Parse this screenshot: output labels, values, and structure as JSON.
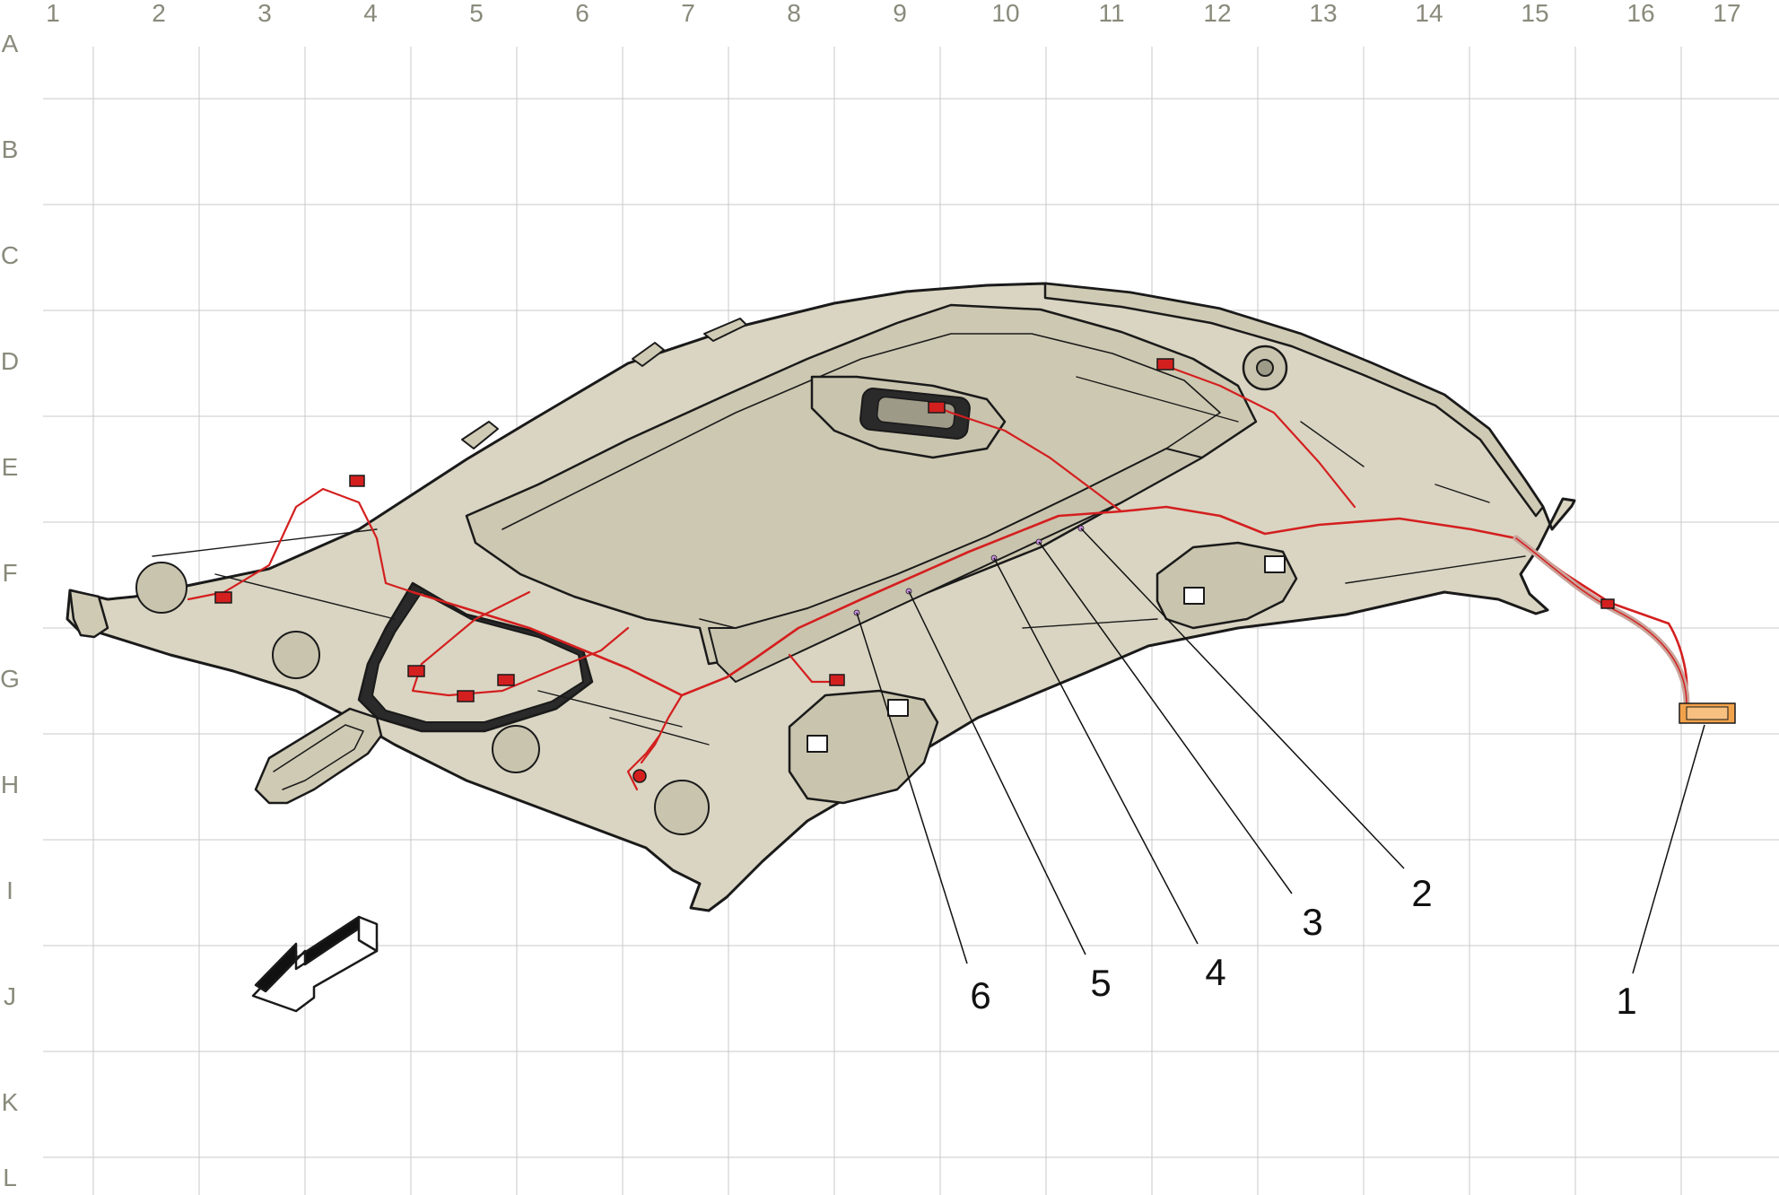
{
  "grid": {
    "columns": [
      "1",
      "2",
      "3",
      "4",
      "5",
      "6",
      "7",
      "8",
      "9",
      "10",
      "11",
      "12",
      "13",
      "14",
      "15",
      "16",
      "17"
    ],
    "rows": [
      "A",
      "B",
      "C",
      "D",
      "E",
      "F",
      "G",
      "H",
      "I",
      "J",
      "K",
      "L"
    ]
  },
  "callouts": [
    {
      "number": "1"
    },
    {
      "number": "2"
    },
    {
      "number": "3"
    },
    {
      "number": "4"
    },
    {
      "number": "5"
    },
    {
      "number": "6"
    }
  ],
  "colors": {
    "grid_line": "#c8c8c8",
    "label_gray": "#8a8a7c",
    "headliner_fill": "#d9d5c2",
    "headliner_shade": "#c9c4ae",
    "outline": "#1a1a1a",
    "harness_red": "#d41f1f",
    "connector_orange": "#f2a24a",
    "pin_violet": "#c98fe0"
  },
  "icons": {
    "direction_arrow": "front-direction-arrow-icon"
  }
}
